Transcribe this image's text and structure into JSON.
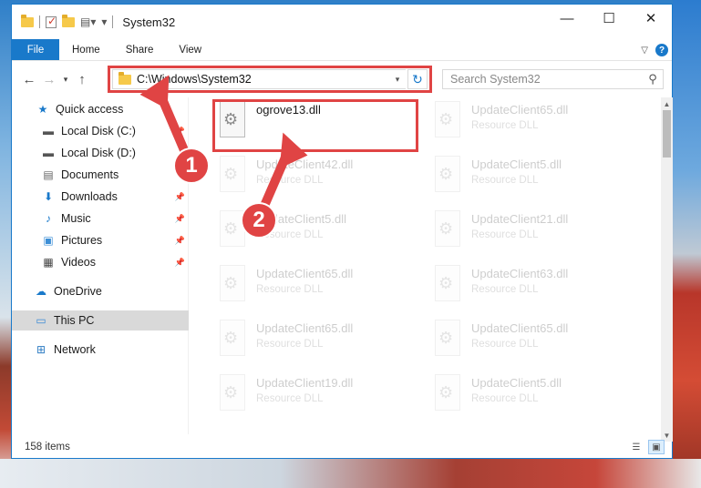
{
  "window": {
    "title": "System32",
    "controls": {
      "minimize": "—",
      "maximize": "☐",
      "close": "✕"
    }
  },
  "ribbon": {
    "tabs": [
      "File",
      "Home",
      "Share",
      "View"
    ],
    "help": "?"
  },
  "nav": {
    "address": "C:\\Windows\\System32",
    "search_placeholder": "Search System32"
  },
  "sidebar": {
    "items": [
      {
        "label": "Quick access",
        "icon": "star-icon"
      },
      {
        "label": "Local Disk (C:)",
        "icon": "drive-icon"
      },
      {
        "label": "Local Disk (D:)",
        "icon": "drive-icon"
      },
      {
        "label": "Documents",
        "icon": "documents-icon"
      },
      {
        "label": "Downloads",
        "icon": "downloads-icon"
      },
      {
        "label": "Music",
        "icon": "music-icon"
      },
      {
        "label": "Pictures",
        "icon": "pictures-icon"
      },
      {
        "label": "Videos",
        "icon": "videos-icon"
      },
      {
        "label": "OneDrive",
        "icon": "cloud-icon"
      },
      {
        "label": "This PC",
        "icon": "computer-icon"
      },
      {
        "label": "Network",
        "icon": "network-icon"
      }
    ],
    "selected": "This PC"
  },
  "files": [
    {
      "name": "ogrove13.dll",
      "type": ""
    },
    {
      "name": "UpdateClient65.dll",
      "type": "Resource DLL"
    },
    {
      "name": "UpdateClient42.dll",
      "type": "Resource DLL"
    },
    {
      "name": "UpdateClient5.dll",
      "type": "Resource DLL"
    },
    {
      "name": "UpdateClient5.dll",
      "type": "Resource DLL"
    },
    {
      "name": "UpdateClient21.dll",
      "type": "Resource DLL"
    },
    {
      "name": "UpdateClient65.dll",
      "type": "Resource DLL"
    },
    {
      "name": "UpdateClient63.dll",
      "type": "Resource DLL"
    },
    {
      "name": "UpdateClient65.dll",
      "type": "Resource DLL"
    },
    {
      "name": "UpdateClient65.dll",
      "type": "Resource DLL"
    },
    {
      "name": "UpdateClient19.dll",
      "type": "Resource DLL"
    },
    {
      "name": "UpdateClient5.dll",
      "type": "Resource DLL"
    }
  ],
  "status": {
    "item_count": "158 items"
  },
  "annotations": {
    "badge_1": "1",
    "badge_2": "2",
    "color": "#e04444"
  }
}
